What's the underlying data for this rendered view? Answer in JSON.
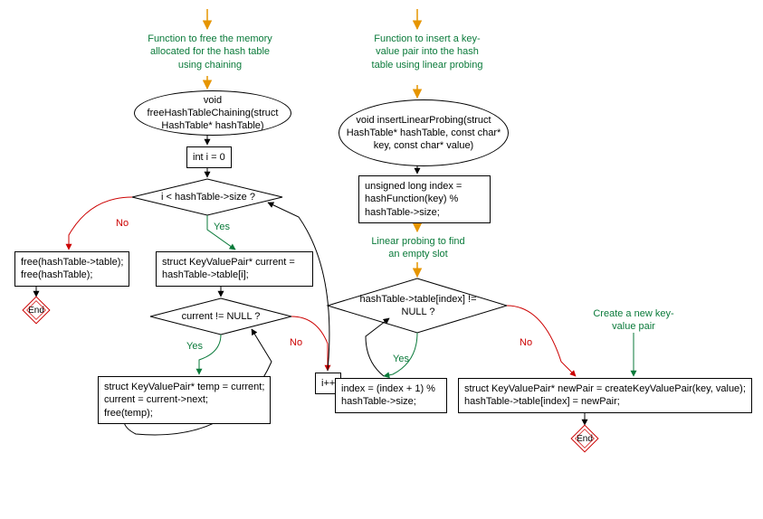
{
  "left": {
    "comment": "Function to free the memory allocated for the hash table using chaining",
    "funcSig": "void freeHashTableChaining(struct HashTable* hashTable)",
    "init": "int i = 0",
    "cond1": "i < hashTable->size ?",
    "no": "No",
    "yes": "Yes",
    "freeBlock": "free(hashTable->table);\nfree(hashTable);",
    "end": "End",
    "assign": "struct KeyValuePair* current = hashTable->table[i];",
    "cond2": "current != NULL ?",
    "loopBody": "struct KeyValuePair* temp = current;\ncurrent = current->next;\nfree(temp);",
    "inc": "i++"
  },
  "right": {
    "comment": "Function to insert a key-value pair into the hash table using linear probing",
    "funcSig": "void insertLinearProbing(struct HashTable* hashTable, const char* key, const char* value)",
    "indexAssign": "unsigned long index = hashFunction(key) % hashTable->size;",
    "probeComment": "Linear probing to find an empty slot",
    "cond": "hashTable->table[index] != NULL ?",
    "yes": "Yes",
    "no": "No",
    "loopBody": "index = (index + 1) % hashTable->size;",
    "createComment": "Create a new key-value pair",
    "createBlock": "struct KeyValuePair* newPair = createKeyValuePair(key, value);\nhashTable->table[index] = newPair;",
    "end": "End"
  }
}
